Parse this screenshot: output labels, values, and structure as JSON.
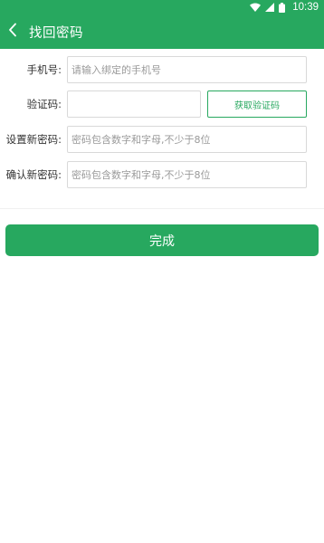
{
  "status_bar": {
    "time": "10:39",
    "icons": [
      "wifi-icon",
      "signal-icon",
      "battery-icon"
    ]
  },
  "app_bar": {
    "back_icon": "chevron-left-icon",
    "title": "找回密码"
  },
  "form": {
    "phone": {
      "label": "手机号:",
      "placeholder": "请输入绑定的手机号",
      "value": ""
    },
    "code": {
      "label": "验证码:",
      "placeholder": "",
      "value": "",
      "button_label": "获取验证码"
    },
    "new_password": {
      "label": "设置新密码:",
      "placeholder": "密码包含数字和字母,不少于8位",
      "value": ""
    },
    "confirm_password": {
      "label": "确认新密码:",
      "placeholder": "密码包含数字和字母,不少于8位",
      "value": ""
    }
  },
  "submit_label": "完成",
  "colors": {
    "brand": "#27a85f",
    "text": "#333333",
    "placeholder": "#9a9a9a",
    "border": "#d9d9d9"
  }
}
